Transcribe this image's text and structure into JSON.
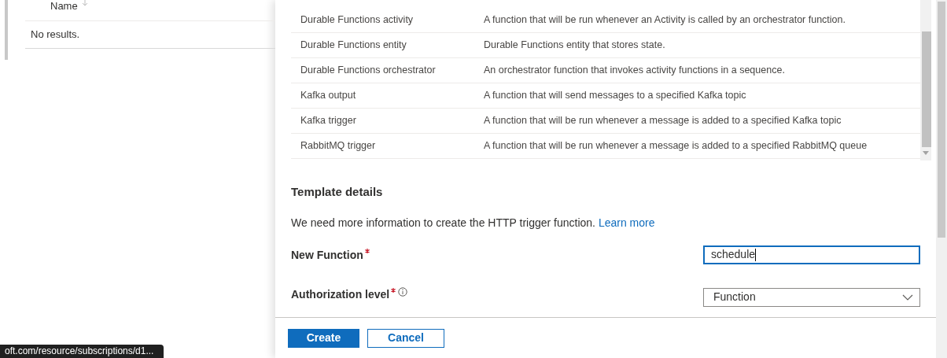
{
  "background_page": {
    "table": {
      "columns": [
        {
          "label": "Name"
        }
      ],
      "empty_message": "No results."
    }
  },
  "templates": {
    "rows": [
      {
        "name": "Durable Functions activity",
        "description": "A function that will be run whenever an Activity is called by an orchestrator function."
      },
      {
        "name": "Durable Functions entity",
        "description": "Durable Functions entity that stores state."
      },
      {
        "name": "Durable Functions orchestrator",
        "description": "An orchestrator function that invokes activity functions in a sequence."
      },
      {
        "name": "Kafka output",
        "description": "A function that will send messages to a specified Kafka topic"
      },
      {
        "name": "Kafka trigger",
        "description": "A function that will be run whenever a message is added to a specified Kafka topic"
      },
      {
        "name": "RabbitMQ trigger",
        "description": "A function that will be run whenever a message is added to a specified RabbitMQ queue"
      }
    ]
  },
  "template_details": {
    "heading": "Template details",
    "intro": "We need more information to create the HTTP trigger function.",
    "link": "Learn more",
    "fields": [
      {
        "kind": "text",
        "label": "New Function",
        "required": true,
        "info": false,
        "value": "schedule",
        "focused": true
      },
      {
        "kind": "dropdown",
        "label": "Authorization level",
        "required": true,
        "info": true,
        "value": "Function",
        "focused": false
      }
    ]
  },
  "buttons": [
    {
      "label": "Create",
      "primary": true
    },
    {
      "label": "Cancel",
      "primary": false
    }
  ],
  "status_url": "oft.com/resource/subscriptions/d1..."
}
